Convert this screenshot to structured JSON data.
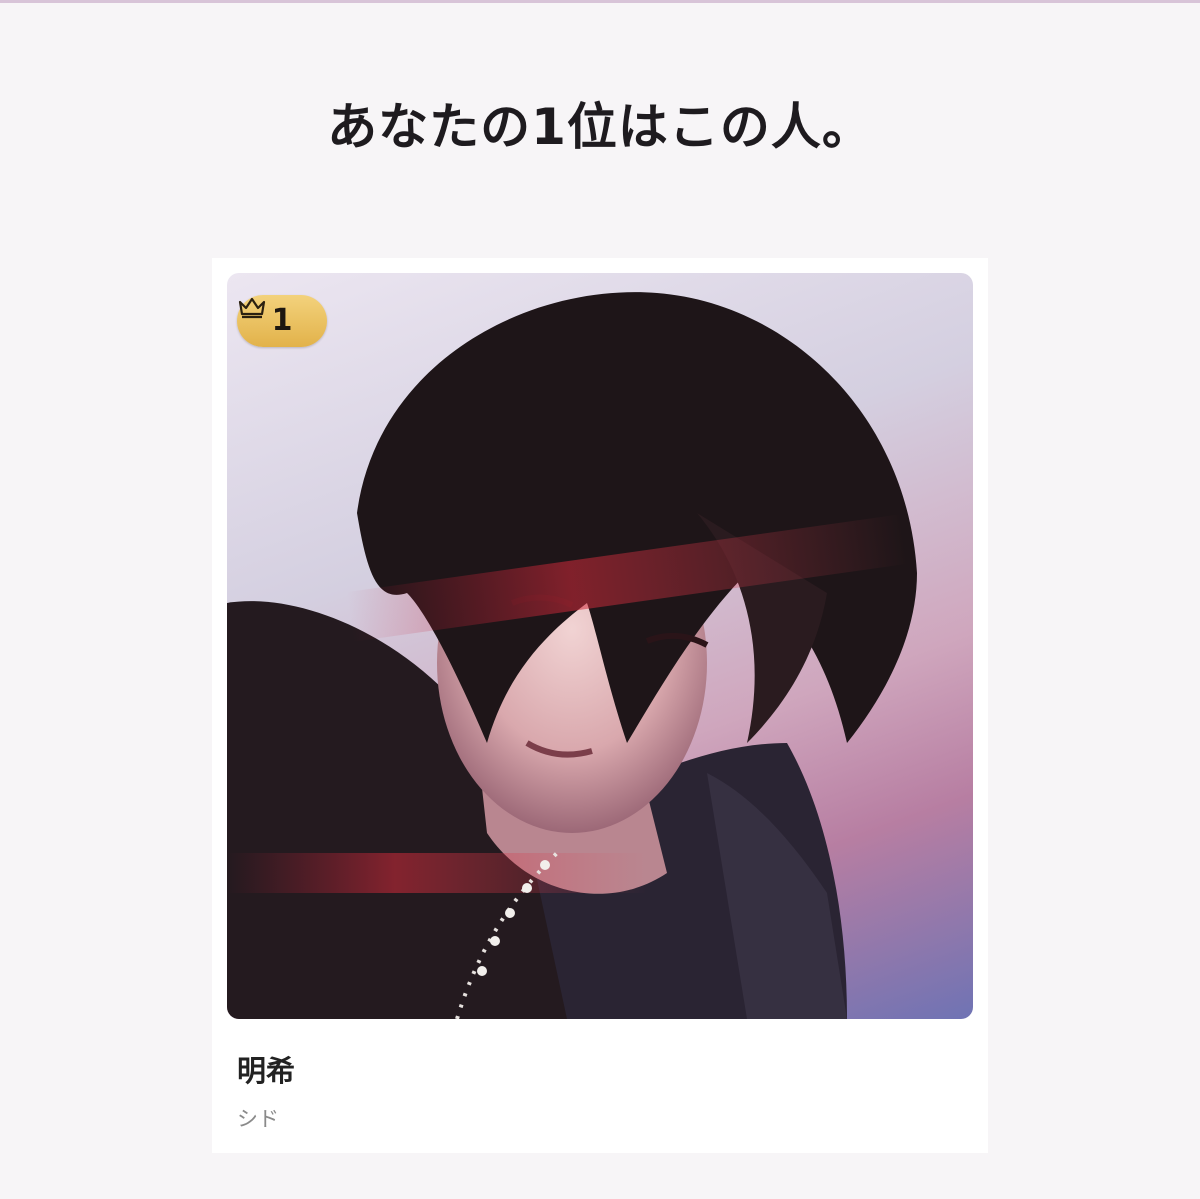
{
  "header": {
    "title": "あなたの1位はこの人。"
  },
  "result": {
    "rank": "1",
    "name": "明希",
    "group": "シド",
    "photo_subject": "portrait-photo",
    "badge_color": "#e8bd58"
  },
  "colors": {
    "background": "#f7f5f7",
    "card": "#ffffff",
    "accent_rule": "#d8c4d8"
  }
}
